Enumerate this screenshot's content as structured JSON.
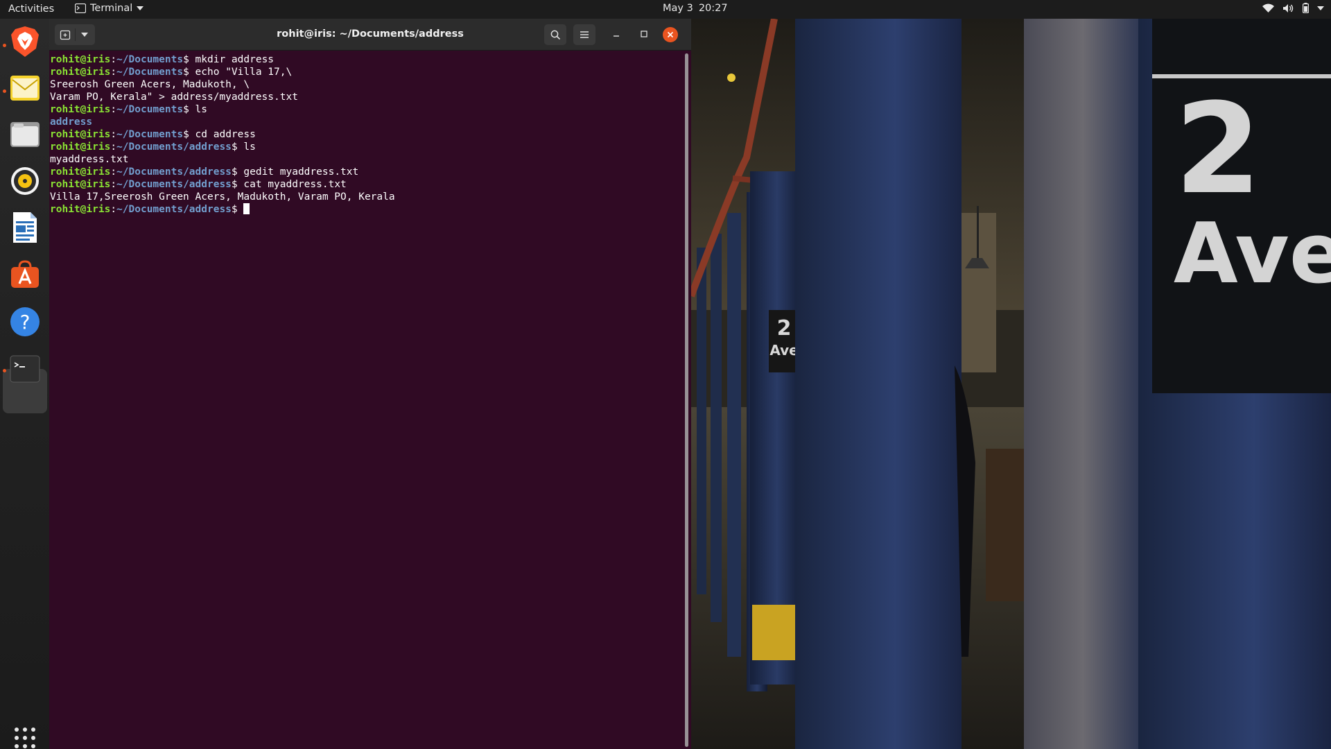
{
  "topbar": {
    "activities": "Activities",
    "app_name": "Terminal",
    "date": "May 3",
    "time": "20:27"
  },
  "dock": {
    "items": [
      {
        "name": "Brave Browser",
        "icon": "brave-icon",
        "running": true
      },
      {
        "name": "Mail",
        "icon": "mail-icon",
        "running": true
      },
      {
        "name": "Files",
        "icon": "files-icon",
        "running": false
      },
      {
        "name": "Rhythmbox",
        "icon": "rhythmbox-icon",
        "running": false
      },
      {
        "name": "LibreOffice Writer",
        "icon": "writer-icon",
        "running": false
      },
      {
        "name": "Ubuntu Software",
        "icon": "software-icon",
        "running": false
      },
      {
        "name": "Help",
        "icon": "help-icon",
        "running": false
      },
      {
        "name": "Terminal",
        "icon": "terminal-icon",
        "running": true
      }
    ],
    "show_apps": "grid-icon"
  },
  "terminal": {
    "title": "rohit@iris: ~/Documents/address",
    "colors": {
      "background": "#300a24",
      "user": "#8ae234",
      "path": "#729fcf"
    },
    "lines": [
      {
        "user": "rohit@iris",
        "path": "~/Documents",
        "cmd": " mkdir address"
      },
      {
        "user": "rohit@iris",
        "path": "~/Documents",
        "cmd": " echo \"Villa 17,\\"
      },
      {
        "out": "Sreerosh Green Acers, Madukoth, \\"
      },
      {
        "out": "Varam PO, Kerala\" > address/myaddress.txt"
      },
      {
        "user": "rohit@iris",
        "path": "~/Documents",
        "cmd": " ls"
      },
      {
        "dir": "address"
      },
      {
        "user": "rohit@iris",
        "path": "~/Documents",
        "cmd": " cd address"
      },
      {
        "user": "rohit@iris",
        "path": "~/Documents/address",
        "cmd": " ls"
      },
      {
        "out": "myaddress.txt"
      },
      {
        "user": "rohit@iris",
        "path": "~/Documents/address",
        "cmd": " gedit myaddress.txt"
      },
      {
        "user": "rohit@iris",
        "path": "~/Documents/address",
        "cmd": " cat myaddress.txt"
      },
      {
        "out": "Villa 17,Sreerosh Green Acers, Madukoth, Varam PO, Kerala"
      },
      {
        "user": "rohit@iris",
        "path": "~/Documents/address",
        "cmd": " ",
        "cursor": true
      }
    ]
  },
  "wallpaper": {
    "sign_number": "2",
    "sign_text": "Ave",
    "small_sign_number": "2",
    "small_sign_text": "Ave"
  }
}
